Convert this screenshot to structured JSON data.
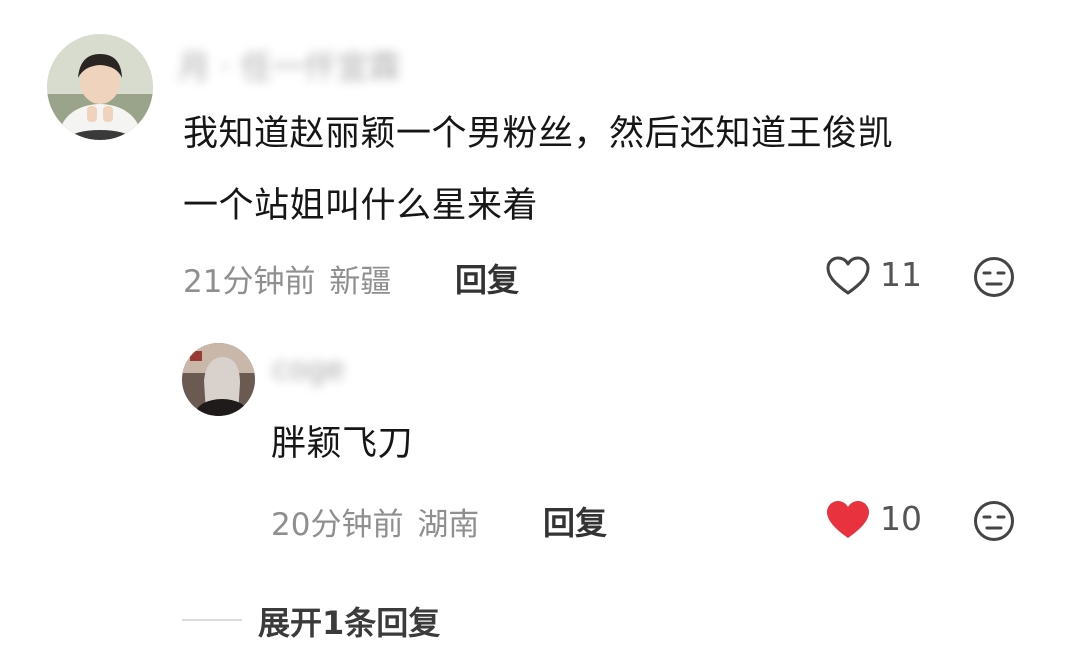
{
  "comment": {
    "username": "月 · 任一仟宜霖",
    "text_line1": "我知道赵丽颖一个男粉丝，然后还知道王俊凯",
    "text_line2": "一个站姐叫什么星来着",
    "time": "21分钟前",
    "location": "新疆",
    "reply_label": "回复",
    "like_count": "11",
    "liked": false,
    "avatar_icon": "user-photo-avatar",
    "heart_icon": "heart-outline-icon",
    "dislike_icon": "neutral-face-icon"
  },
  "reply": {
    "username": "coge",
    "text": "胖颖飞刀",
    "time": "20分钟前",
    "location": "湖南",
    "reply_label": "回复",
    "like_count": "10",
    "liked": true,
    "avatar_icon": "user-photo-avatar",
    "heart_icon": "heart-filled-icon",
    "dislike_icon": "neutral-face-icon"
  },
  "expand": {
    "label": "展开1条回复"
  },
  "colors": {
    "liked_heart": "#e8323d",
    "meta_gray": "#8f8f8f",
    "text_dark": "#161616"
  }
}
